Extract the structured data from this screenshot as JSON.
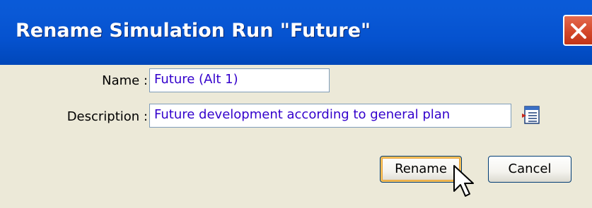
{
  "dialog": {
    "title": "Rename Simulation Run \"Future\""
  },
  "form": {
    "name_label": "Name :",
    "name_value": "Future (Alt 1)",
    "description_label": "Description :",
    "description_value": "Future development according to general plan"
  },
  "buttons": {
    "rename_label": "Rename",
    "cancel_label": "Cancel"
  },
  "colors": {
    "titlebar": "#0a59d6",
    "close_button": "#d4482a",
    "field_text": "#3300cc",
    "dialog_background": "#ece9d8"
  },
  "icons": {
    "close": "close-icon",
    "edit_description": "edit-description-icon",
    "cursor": "mouse-pointer-icon"
  }
}
